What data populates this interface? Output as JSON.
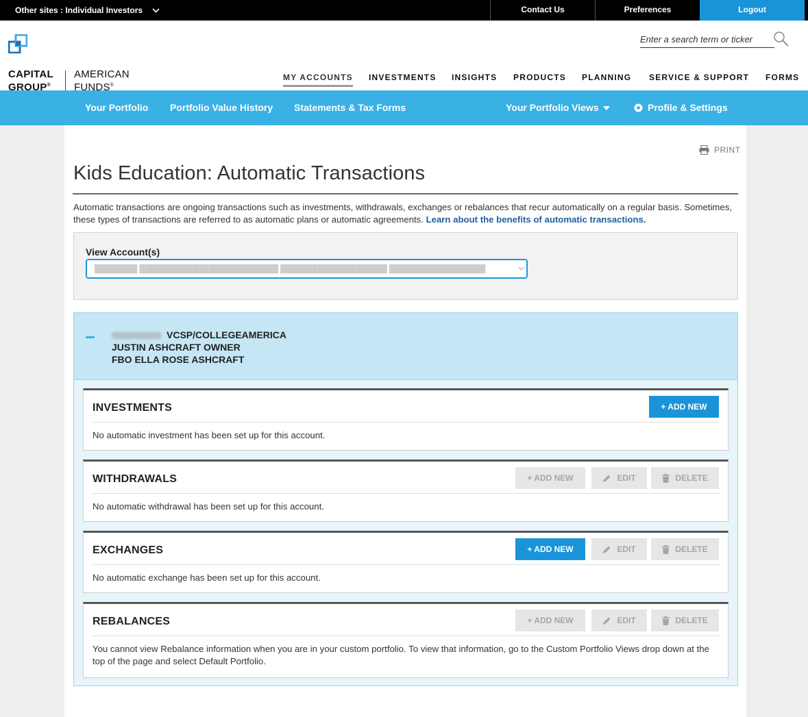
{
  "topbar": {
    "other_sites": "Other sites : Individual Investors",
    "contact": "Contact Us",
    "preferences": "Preferences",
    "logout": "Logout"
  },
  "header": {
    "logo_line1": "CAPITAL",
    "logo_line2": "GROUP",
    "logo_af1": "AMERICAN",
    "logo_af2": "FUNDS",
    "search_placeholder": "Enter a search term or ticker",
    "nav": [
      "MY ACCOUNTS",
      "INVESTMENTS",
      "INSIGHTS",
      "PRODUCTS",
      "PLANNING",
      "SERVICE & SUPPORT",
      "FORMS"
    ]
  },
  "subnav": {
    "portfolio": "Your Portfolio",
    "history": "Portfolio Value History",
    "statements": "Statements & Tax Forms",
    "views": "Your Portfolio Views",
    "settings": "Profile & Settings"
  },
  "page": {
    "print": "PRINT",
    "title": "Kids Education: Automatic Transactions",
    "intro_text": "Automatic transactions are ongoing transactions such as investments, withdrawals, exchanges or rebalances that recur automatically on a regular basis. Sometimes, these types of transactions are referred to as automatic plans or automatic agreements. ",
    "intro_link": "Learn about the benefits of automatic transactions.",
    "view_label": "View Account(s)"
  },
  "account": {
    "line1": "VCSP/COLLEGEAMERICA",
    "line2": "JUSTIN ASHCRAFT OWNER",
    "line3": "FBO ELLA ROSE ASHCRAFT"
  },
  "sections": {
    "investments": {
      "title": "INVESTMENTS",
      "message": "No automatic investment has been set up for this account."
    },
    "withdrawals": {
      "title": "WITHDRAWALS",
      "message": "No automatic withdrawal has been set up for this account."
    },
    "exchanges": {
      "title": "EXCHANGES",
      "message": "No automatic exchange has been set up for this account."
    },
    "rebalances": {
      "title": "REBALANCES",
      "message": "You cannot view Rebalance information when you are in your custom portfolio. To view that information, go to the Custom Portfolio Views drop down at the top of the page and select Default Portfolio."
    }
  },
  "buttons": {
    "add_new": "+ ADD NEW",
    "edit": "EDIT",
    "delete": "DELETE"
  },
  "colors": {
    "accent_blue": "#3ab1e4",
    "button_blue": "#1a94d8",
    "link_blue": "#1f5f9c"
  }
}
